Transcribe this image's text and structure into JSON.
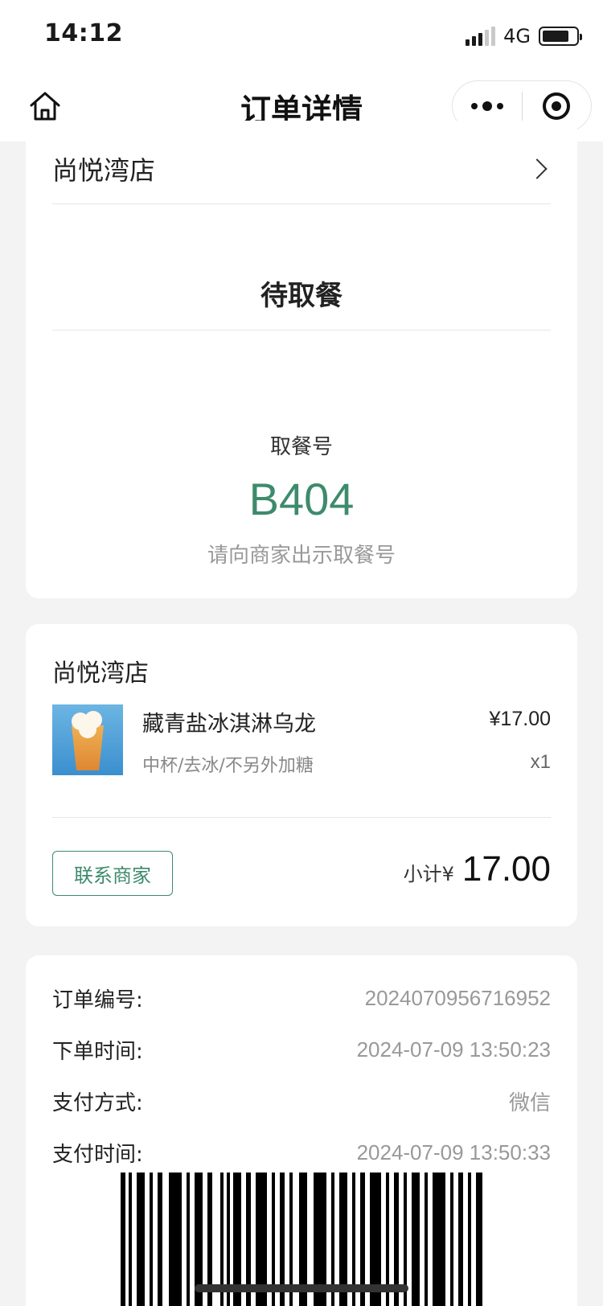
{
  "status_bar": {
    "time": "14:12",
    "network": "4G"
  },
  "nav": {
    "title": "订单详情"
  },
  "order_status": {
    "store_name": "尚悦湾店",
    "status": "待取餐",
    "pickup_label": "取餐号",
    "pickup_number": "B404",
    "pickup_hint": "请向商家出示取餐号"
  },
  "order_items": {
    "store_name": "尚悦湾店",
    "items": [
      {
        "name": "藏青盐冰淇淋乌龙",
        "spec": "中杯/去冰/不另外加糖",
        "price": "¥17.00",
        "qty": "x1"
      }
    ],
    "contact_label": "联系商家",
    "subtotal_label": "小计¥",
    "subtotal_value": "17.00"
  },
  "order_info": [
    {
      "label": "订单编号:",
      "value": "2024070956716952"
    },
    {
      "label": "下单时间:",
      "value": "2024-07-09 13:50:23"
    },
    {
      "label": "支付方式:",
      "value": "微信"
    },
    {
      "label": "支付时间:",
      "value": "2024-07-09 13:50:33"
    }
  ],
  "colors": {
    "accent": "#3d8b6c",
    "background": "#f3f3f3"
  },
  "icons": [
    "home-icon",
    "more-icon",
    "close-mini-program-icon",
    "chevron-right-icon",
    "barcode"
  ]
}
